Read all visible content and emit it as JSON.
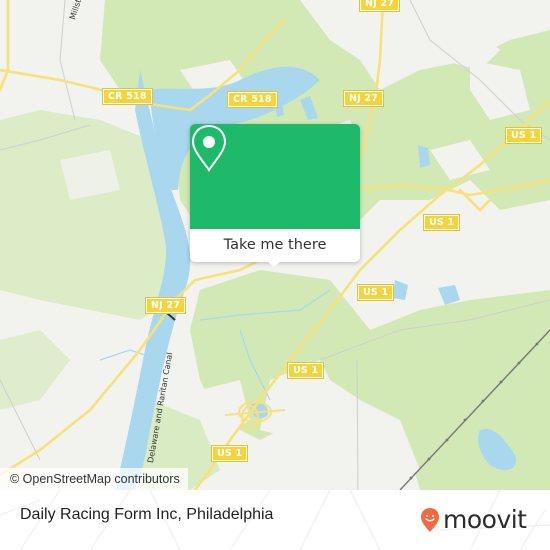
{
  "map": {
    "road_shields": [
      {
        "id": "cr518-top",
        "label": "CR 518"
      },
      {
        "id": "cr518-left",
        "label": "CR 518"
      },
      {
        "id": "nj27-top",
        "label": "NJ 27"
      },
      {
        "id": "nj27-mid",
        "label": "NJ 27"
      },
      {
        "id": "nj27-left",
        "label": "NJ 27"
      },
      {
        "id": "us1-right",
        "label": "US 1"
      },
      {
        "id": "us1-mid-right",
        "label": "US 1"
      },
      {
        "id": "us1-mid",
        "label": "US 1"
      },
      {
        "id": "us1-center",
        "label": "US 1"
      },
      {
        "id": "us1-bottom",
        "label": "US 1"
      }
    ],
    "labels": {
      "millstone": "Millstone R",
      "canal": "Delaware and Raritan Canal"
    },
    "colors": {
      "land": "#f2f2ef",
      "forest": "#cfe8b0",
      "water": "#a9d8ee",
      "road": "#f7e17a",
      "shield": "#f2d53c"
    }
  },
  "popup": {
    "icon": "map-pin-icon",
    "cta_label": "Take me there",
    "color": "#1fba69"
  },
  "attribution": "© OpenStreetMap contributors",
  "footer": {
    "place_name": "Daily Racing Form Inc, Philadelphia",
    "logo_text": "moovit",
    "logo_color": "#f26a3d"
  }
}
